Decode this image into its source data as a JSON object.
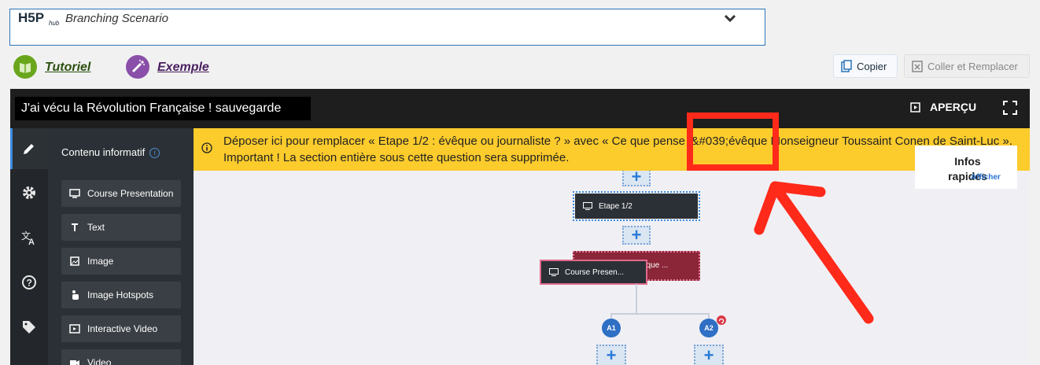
{
  "library_selector": {
    "logo_text": "H5P hub",
    "name": "Branching Scenario"
  },
  "links": {
    "tutorial": "Tutoriel",
    "example": "Exemple"
  },
  "actions": {
    "copy": "Copier",
    "paste_replace": "Coller et Remplacer"
  },
  "editor": {
    "title": "J'ai vécu la Révolution Française ! sauvegarde",
    "preview": "APERÇU",
    "sidebar_icons": [
      "pencil-icon",
      "gear-icon",
      "translate-icon",
      "help-icon",
      "tag-icon"
    ],
    "content_panel_title": "Contenu informatif",
    "content_types": [
      {
        "label": "Course Presentation",
        "icon": "monitor-icon"
      },
      {
        "label": "Text",
        "icon": "text-icon"
      },
      {
        "label": "Image",
        "icon": "image-icon"
      },
      {
        "label": "Image Hotspots",
        "icon": "hand-icon"
      },
      {
        "label": "Interactive Video",
        "icon": "video-play-icon"
      },
      {
        "label": "Video",
        "icon": "camera-icon"
      }
    ],
    "warning": "Déposer ici pour remplacer « Etape 1/2 : évêque ou journaliste ? » avec « Ce que pense l&#039;évêque Monseigneur Toussaint Conen de Saint-Luc ». Important ! La section entière sous cette question sera supprimée.",
    "quick_info": {
      "title": "Infos rapides",
      "show": "Afficher"
    },
    "nodes": {
      "step": "Etape 1/2",
      "question_fragment": "êque ...",
      "dragging": "Course Presen..."
    },
    "alternatives": [
      "A1",
      "A2"
    ],
    "dropzone_symbol": "+"
  },
  "colors": {
    "accent": "#2a74b8",
    "warning": "#fccb2c",
    "node_dark": "#2b3036",
    "node_question": "#8a2638",
    "annotation": "#ff2a1a"
  }
}
